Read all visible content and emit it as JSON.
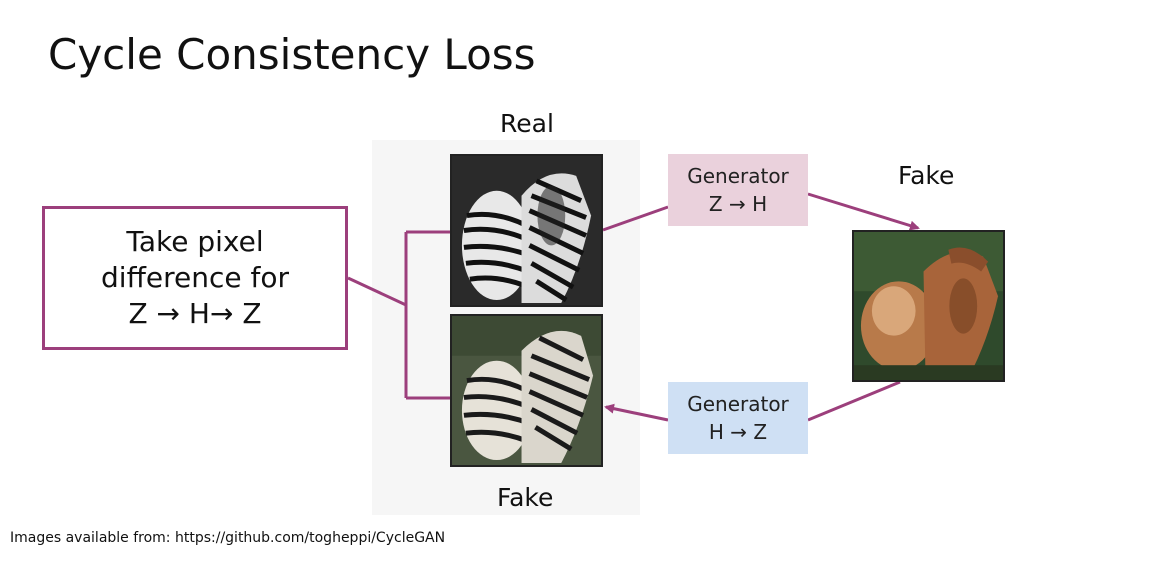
{
  "title": "Cycle Consistency Loss",
  "labels": {
    "real": "Real",
    "fake_right": "Fake",
    "fake_bottom": "Fake"
  },
  "generators": [
    {
      "name": "Generator",
      "mapping": "Z → H",
      "color": "#ead1dc"
    },
    {
      "name": "Generator",
      "mapping": "H → Z",
      "color": "#cfe0f4"
    }
  ],
  "note": {
    "line1": "Take pixel",
    "line2": "difference for",
    "line3": "Z → H→ Z"
  },
  "footnote": "Images available from: https://github.com/togheppi/CycleGAN",
  "colors": {
    "connector": "#9c3f7c"
  },
  "images": {
    "real": "zebra photo",
    "fake_zebra": "zebra photo",
    "fake_horse": "horse photo"
  }
}
